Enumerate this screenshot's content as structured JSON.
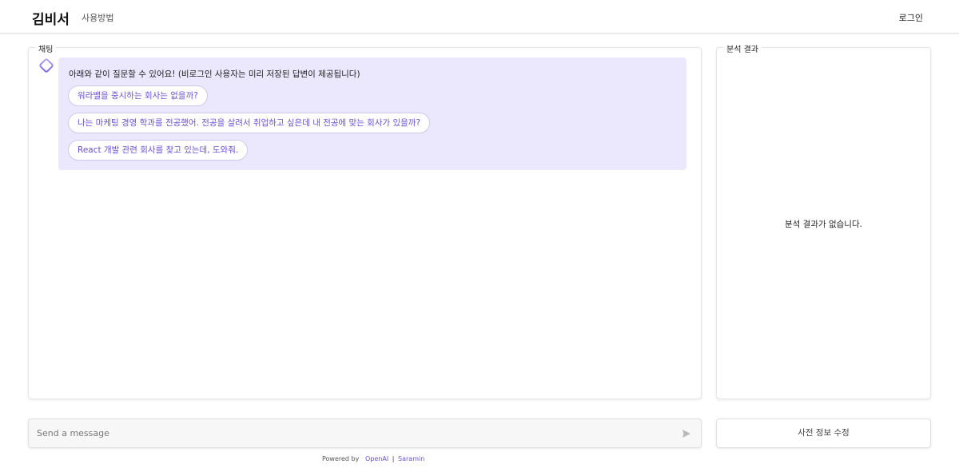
{
  "header": {
    "logo": "김비서",
    "nav_howto": "사용방법",
    "login": "로그인"
  },
  "chat": {
    "title": "채팅",
    "intro": "아래와 같이 질문할 수 있어요! (비로그인 사용자는 미리 저장된 답변이 제공됩니다)",
    "suggestions": [
      "워라밸을 중시하는 회사는 없을까?",
      "나는 마케팅 경영 학과를 전공했어. 전공을 살려서 취업하고 싶은데 내 전공에 맞는 회사가 있을까?",
      "React 개발 관련 회사를 찾고 있는데, 도와줘."
    ]
  },
  "result": {
    "title": "분석 결과",
    "empty": "분석 결과가 없습니다."
  },
  "input": {
    "placeholder": "Send a message",
    "value": ""
  },
  "edit_button": "사전 정보 수정",
  "footer": {
    "powered_by": "Powered by",
    "openai": "OpenAI",
    "separator": "|",
    "saramin": "Saramin"
  },
  "colors": {
    "accent": "#6a4fd8",
    "bubble_bg": "#ebe7fd",
    "border": "#e4e4e4"
  },
  "icons": {
    "bot": "diamond-icon",
    "send": "send-icon"
  }
}
